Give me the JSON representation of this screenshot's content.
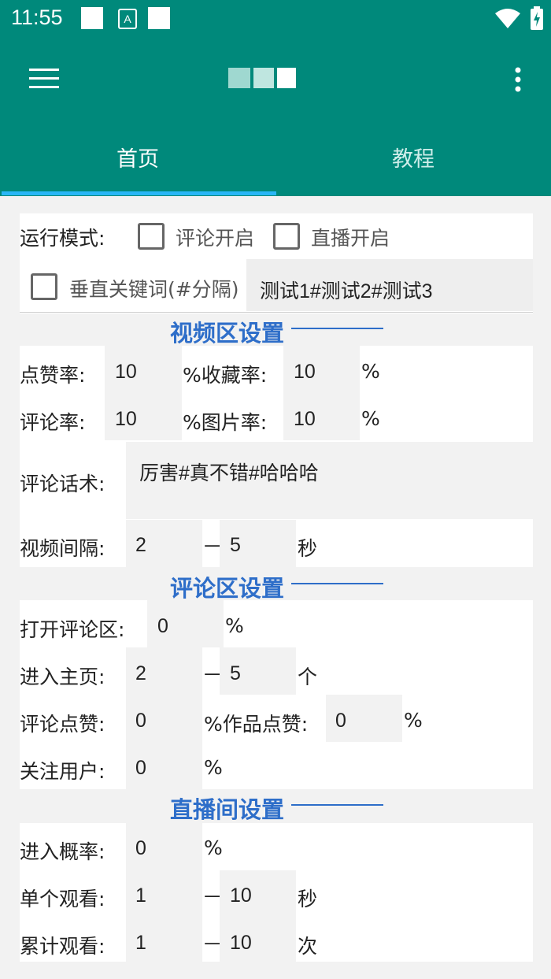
{
  "status_bar": {
    "time": "11:55"
  },
  "app_bar": {
    "menu_icon": "hamburger-menu-icon",
    "more_icon": "overflow-menu-icon"
  },
  "tabs": [
    {
      "label": "首页"
    },
    {
      "label": "教程"
    }
  ],
  "run_mode": {
    "label": "运行模式:",
    "comment_option": "评论开启",
    "live_option": "直播开启"
  },
  "keyword": {
    "label": "垂直关键词(#分隔)",
    "value": "测试1#测试2#测试3"
  },
  "video_section": {
    "title": "视频区设置",
    "like_rate_label": "点赞率:",
    "like_rate": "10",
    "pct_fav": "%收藏率:",
    "fav_rate": "10",
    "pct1": "%",
    "comment_rate_label": "评论率:",
    "comment_rate": "10",
    "pct_img": "%图片率:",
    "img_rate": "10",
    "pct2": "%",
    "speech_label": "评论话术:",
    "speech": "厉害#真不错#哈哈哈",
    "interval_label": "视频间隔:",
    "interval_min": "2",
    "dash": "—",
    "interval_max": "5",
    "unit": "秒"
  },
  "comment_section": {
    "title": "评论区设置",
    "open_label": "打开评论区:",
    "open_rate": "0",
    "pct": "%",
    "home_label": "进入主页:",
    "home_min": "2",
    "dash": "—",
    "home_max": "5",
    "home_unit": "个",
    "like_label": "评论点赞:",
    "like_rate": "0",
    "pct_work": "%作品点赞:",
    "work_rate": "0",
    "pct2": "%",
    "follow_label": "关注用户:",
    "follow_rate": "0",
    "pct3": "%"
  },
  "live_section": {
    "title": "直播间设置",
    "enter_label": "进入概率:",
    "enter_rate": "0",
    "pct": "%",
    "single_label": "单个观看:",
    "single_min": "1",
    "dash": "—",
    "single_max": "10",
    "single_unit": "秒",
    "total_label": "累计观看:",
    "total_min": "1",
    "dash2": "—",
    "total_max": "10",
    "total_unit": "次"
  },
  "colors": {
    "primary": "#00897b",
    "accent": "#29b6f6",
    "section_title": "#2e6ec9"
  }
}
